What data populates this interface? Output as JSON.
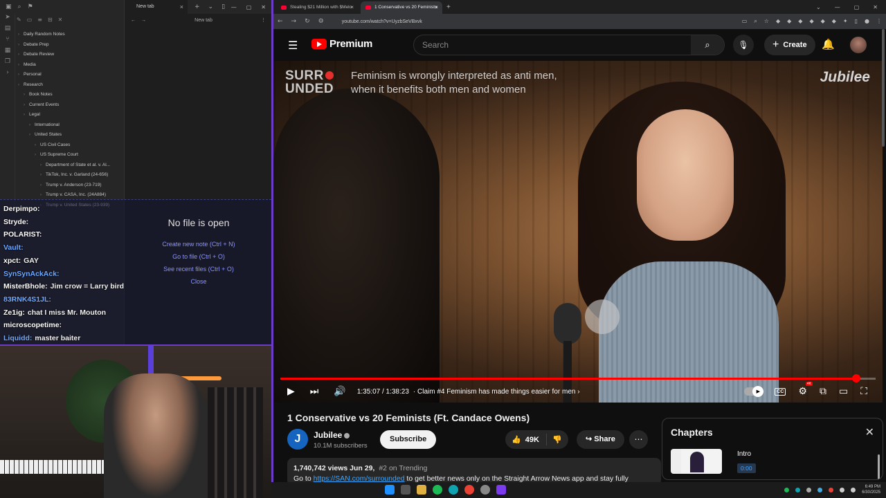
{
  "obsidian": {
    "tab_title": "New tab",
    "nav_title": "New tab",
    "tree": [
      {
        "label": "Daily Random Notes",
        "indent": 0
      },
      {
        "label": "Debate Prep",
        "indent": 0
      },
      {
        "label": "Debate Review",
        "indent": 0
      },
      {
        "label": "Media",
        "indent": 0
      },
      {
        "label": "Personal",
        "indent": 0
      },
      {
        "label": "Research",
        "indent": 0
      },
      {
        "label": "Book Notes",
        "indent": 1
      },
      {
        "label": "Current Events",
        "indent": 1
      },
      {
        "label": "Legal",
        "indent": 1
      },
      {
        "label": "International",
        "indent": 2
      },
      {
        "label": "United States",
        "indent": 2
      },
      {
        "label": "US Civil Cases",
        "indent": 3
      },
      {
        "label": "US Supreme Court",
        "indent": 3
      },
      {
        "label": "Department of State et al. v. Al...",
        "indent": 4
      },
      {
        "label": "TikTok, Inc. v. Garland (24-656)",
        "indent": 4
      },
      {
        "label": "Trump v. Anderson (23-719)",
        "indent": 4
      },
      {
        "label": "Trump v. CASA, Inc. (24A884)",
        "indent": 4
      },
      {
        "label": "Trump v. United States (23-939)",
        "indent": 4
      }
    ],
    "no_file": {
      "heading": "No file is open",
      "create": "Create new note (Ctrl + N)",
      "goto": "Go to file (Ctrl + O)",
      "recent": "See recent files (Ctrl + O)",
      "close": "Close"
    }
  },
  "chat": [
    {
      "user": "Derpimpo:",
      "msg": "",
      "blue": false
    },
    {
      "user": "Stryde:",
      "msg": "",
      "blue": false
    },
    {
      "user": "POLARIST:",
      "msg": "",
      "blue": false
    },
    {
      "user": "Vault:",
      "msg": "",
      "blue": true
    },
    {
      "user": "xpct:",
      "msg": "GAY",
      "blue": false
    },
    {
      "user": "SynSynAckAck:",
      "msg": "",
      "blue": true
    },
    {
      "user": "MisterBhole:",
      "msg": "Jim crow = Larry bird",
      "blue": false
    },
    {
      "user": "83RNK4S1JL:",
      "msg": "",
      "blue": true
    },
    {
      "user": "Ze1ig:",
      "msg": "chat I miss Mr. Mouton",
      "blue": false
    },
    {
      "user": "microscopetime:",
      "msg": "",
      "blue": false
    },
    {
      "user": "Liquidd:",
      "msg": "master baiter",
      "blue": true
    }
  ],
  "browser": {
    "tabs": [
      {
        "label": "Stealing $21 Million with $Melo",
        "active": false
      },
      {
        "label": "1 Conservative vs 20 Feminists",
        "active": true
      }
    ],
    "url": "youtube.com/watch?v=UyzbSeVBxvk"
  },
  "youtube": {
    "logo_text": "Premium",
    "search_placeholder": "Search",
    "create_label": "Create",
    "video": {
      "brand_line1": "SURR",
      "brand_line2": "UNDED",
      "caption_line1": "Feminism is wrongly interpreted as anti men,",
      "caption_line2": "when it benefits both men and women",
      "watermark": "Jubilee",
      "time": "1:35:07 / 1:38:23",
      "chapter": "Claim #4 Feminism has made things easier for men",
      "progress": 0.967,
      "hd_badge": "4K"
    },
    "title": "1 Conservative vs 20 Feminists (Ft. Candace Owens)",
    "channel": {
      "name": "Jubilee",
      "initial": "J",
      "subs": "10.1M subscribers"
    },
    "subscribe": "Subscribe",
    "likes": "49K",
    "share": "Share",
    "description": {
      "views": "1,740,742 views",
      "date": "Jun 29,",
      "trending": "#2 on Trending",
      "line2_pre": "Go to ",
      "link": "https://SAN.com/surrounded",
      "line2_post": " to get better news only on the Straight Arrow News app and stay fully"
    },
    "chapters": {
      "heading": "Chapters",
      "item_title": "Intro",
      "item_time": "0:00"
    }
  },
  "taskbar": {
    "time": "6:49 PM",
    "date": "6/30/2025"
  },
  "colors": {
    "accent": "#ff0000",
    "link": "#3ea6ff",
    "obsidian_link": "#8a93ff",
    "stream_border": "#6a3cc8"
  }
}
